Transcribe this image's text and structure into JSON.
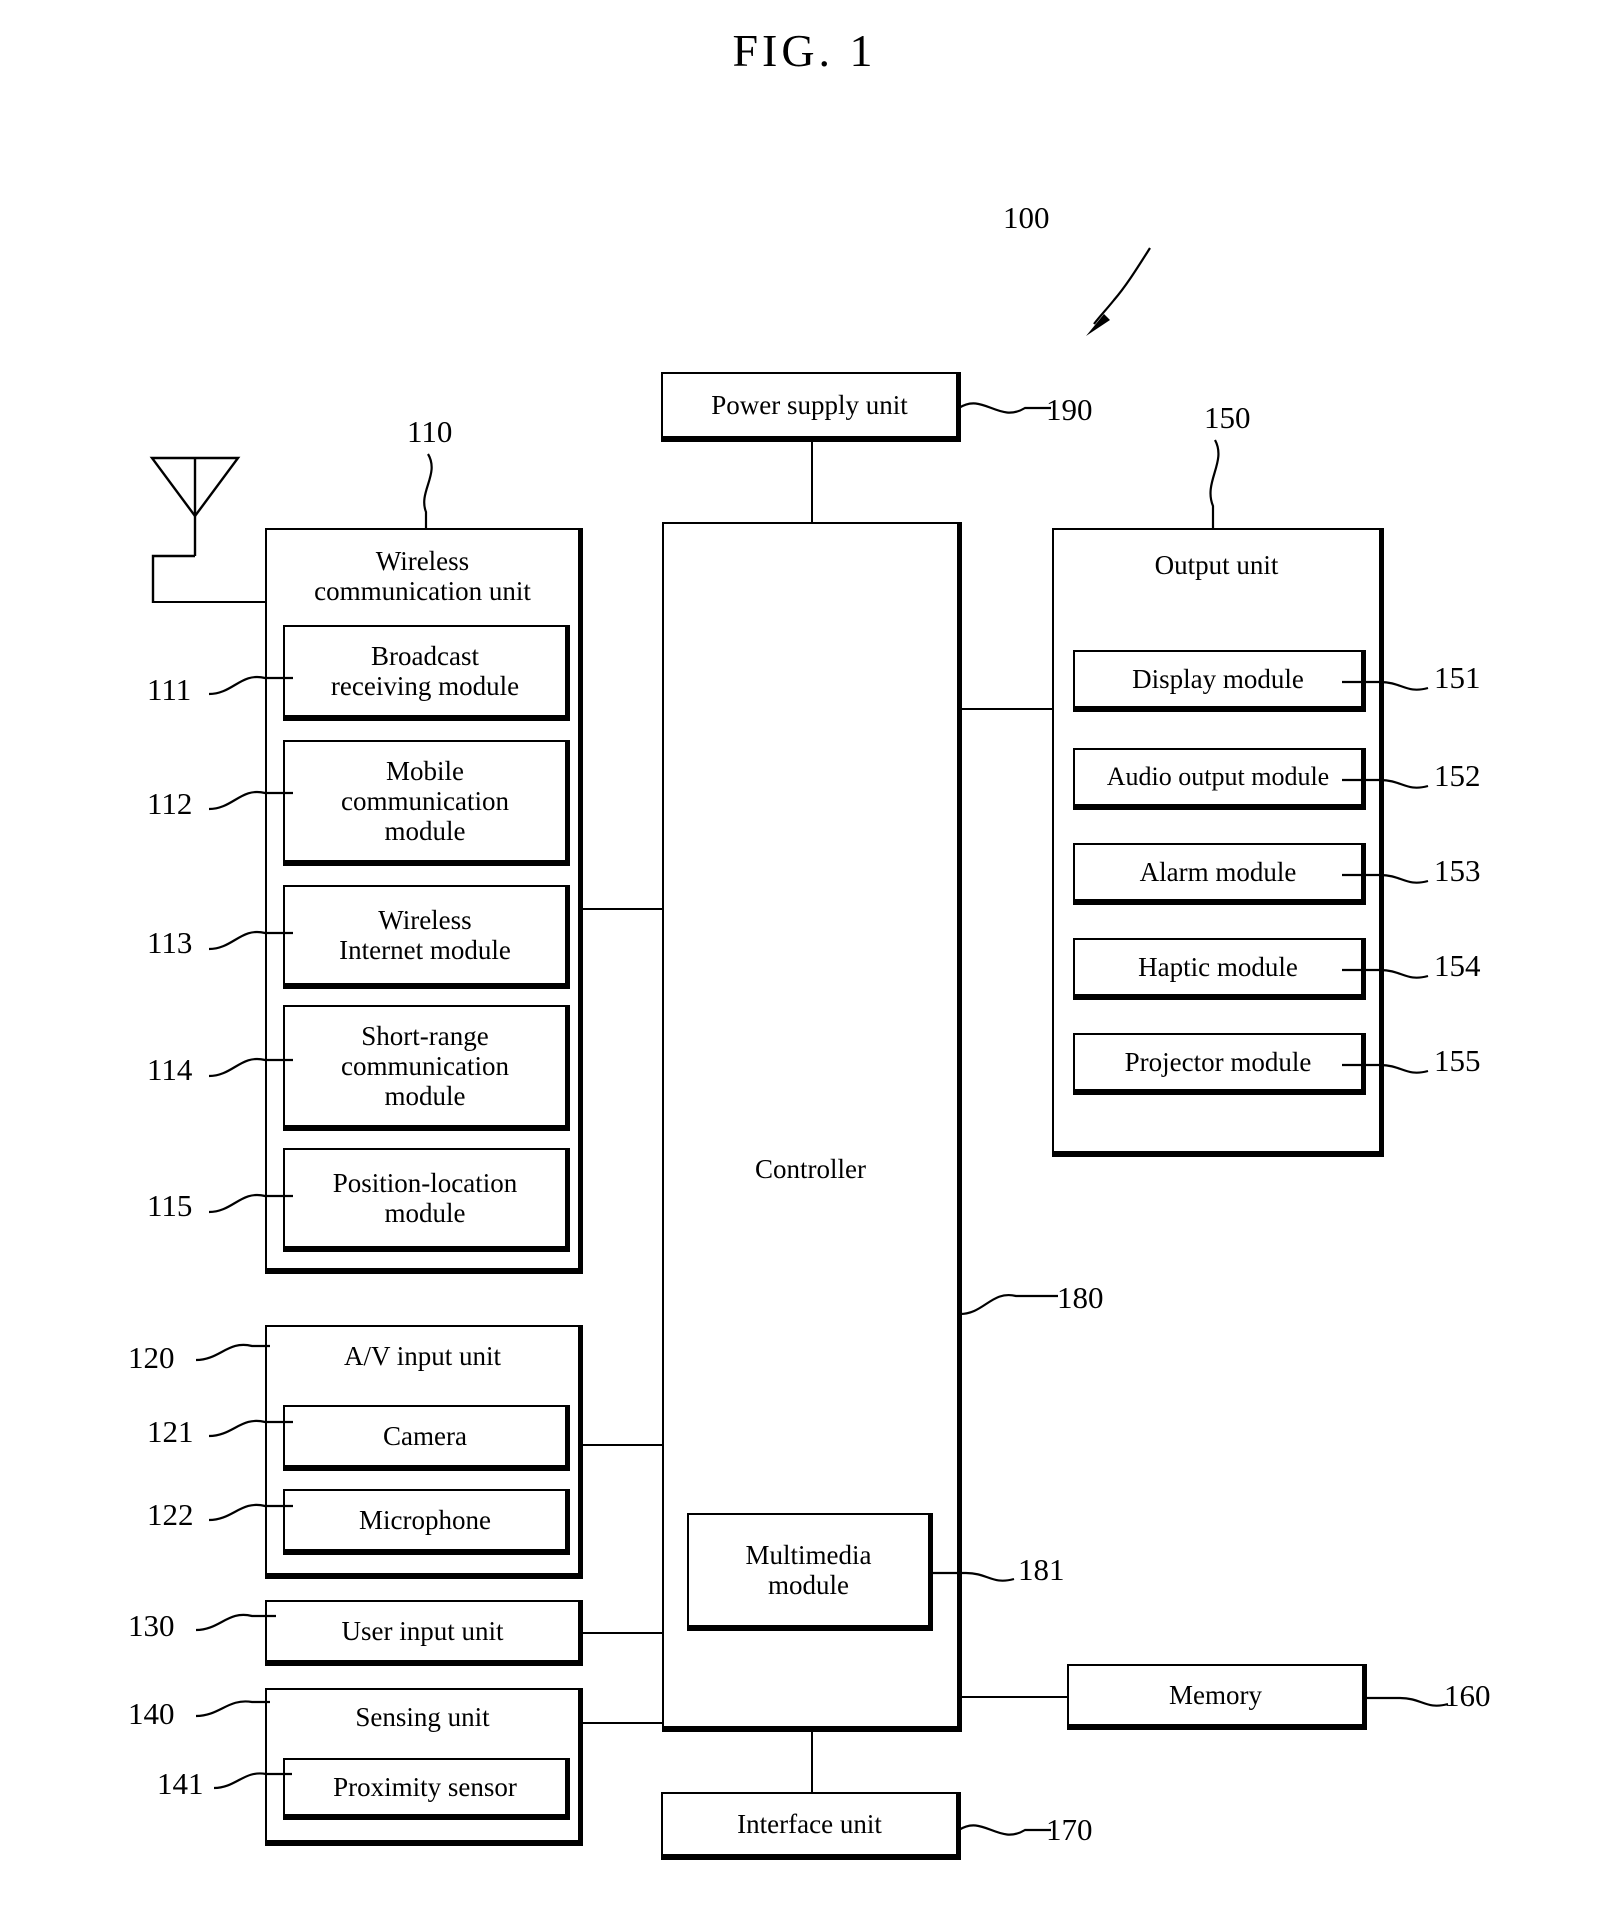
{
  "figure": {
    "title": "FIG. 1",
    "device_ref": "100"
  },
  "blocks": {
    "power_supply": {
      "label": "Power supply unit",
      "ref": "190"
    },
    "wireless_unit": {
      "label_line1": "Wireless",
      "label_line2": "communication unit",
      "ref": "110",
      "modules": [
        {
          "label_line1": "Broadcast",
          "label_line2": "receiving module",
          "ref": "111"
        },
        {
          "label_line1": "Mobile",
          "label_line2": "communication",
          "label_line3": "module",
          "ref": "112"
        },
        {
          "label_line1": "Wireless",
          "label_line2": "Internet module",
          "ref": "113"
        },
        {
          "label_line1": "Short-range",
          "label_line2": "communication",
          "label_line3": "module",
          "ref": "114"
        },
        {
          "label_line1": "Position-location",
          "label_line2": "module",
          "ref": "115"
        }
      ]
    },
    "av_input_unit": {
      "label": "A/V input unit",
      "ref": "120",
      "modules": [
        {
          "label": "Camera",
          "ref": "121"
        },
        {
          "label": "Microphone",
          "ref": "122"
        }
      ]
    },
    "user_input_unit": {
      "label": "User input unit",
      "ref": "130"
    },
    "sensing_unit": {
      "label": "Sensing unit",
      "ref": "140",
      "modules": [
        {
          "label": "Proximity sensor",
          "ref": "141"
        }
      ]
    },
    "controller": {
      "label": "Controller",
      "ref": "180",
      "modules": [
        {
          "label_line1": "Multimedia",
          "label_line2": "module",
          "ref": "181"
        }
      ]
    },
    "output_unit": {
      "label": "Output unit",
      "ref": "150",
      "modules": [
        {
          "label": "Display module",
          "ref": "151"
        },
        {
          "label": "Audio output module",
          "ref": "152"
        },
        {
          "label": "Alarm module",
          "ref": "153"
        },
        {
          "label": "Haptic module",
          "ref": "154"
        },
        {
          "label": "Projector module",
          "ref": "155"
        }
      ]
    },
    "memory": {
      "label": "Memory",
      "ref": "160"
    },
    "interface_unit": {
      "label": "Interface unit",
      "ref": "170"
    }
  }
}
